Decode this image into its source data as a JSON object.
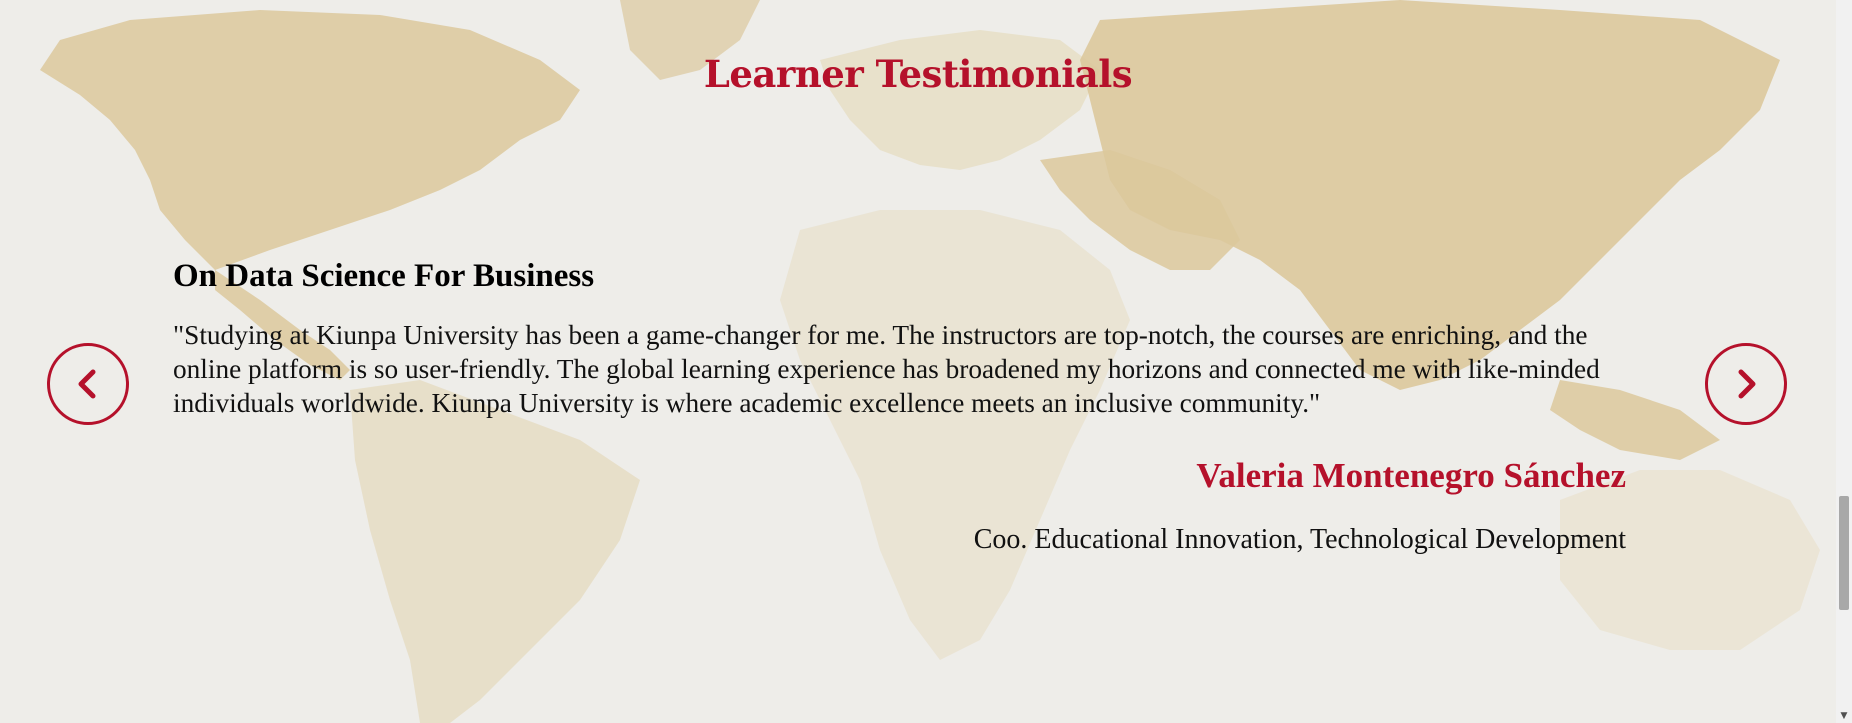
{
  "section": {
    "title": "Learner Testimonials"
  },
  "testimonial": {
    "course": "On Data Science For Business",
    "quote": "\"Studying at Kiunpa University has been a game-changer for me. The instructors are top-notch, the courses are enriching, and the online platform is so user-friendly. The global learning experience has broadened my horizons and connected me with like-minded individuals worldwide. Kiunpa University is where academic excellence meets an inclusive community.\"",
    "author": "Valeria Montenegro Sánchez",
    "role": "Coo. Educational Innovation, Technological Development"
  },
  "controls": {
    "prev_icon": "chevron-left-icon",
    "next_icon": "chevron-right-icon"
  },
  "colors": {
    "accent": "#b5112b",
    "background": "#eeede9",
    "map_land": "#dfcfa6",
    "text": "#111111"
  }
}
